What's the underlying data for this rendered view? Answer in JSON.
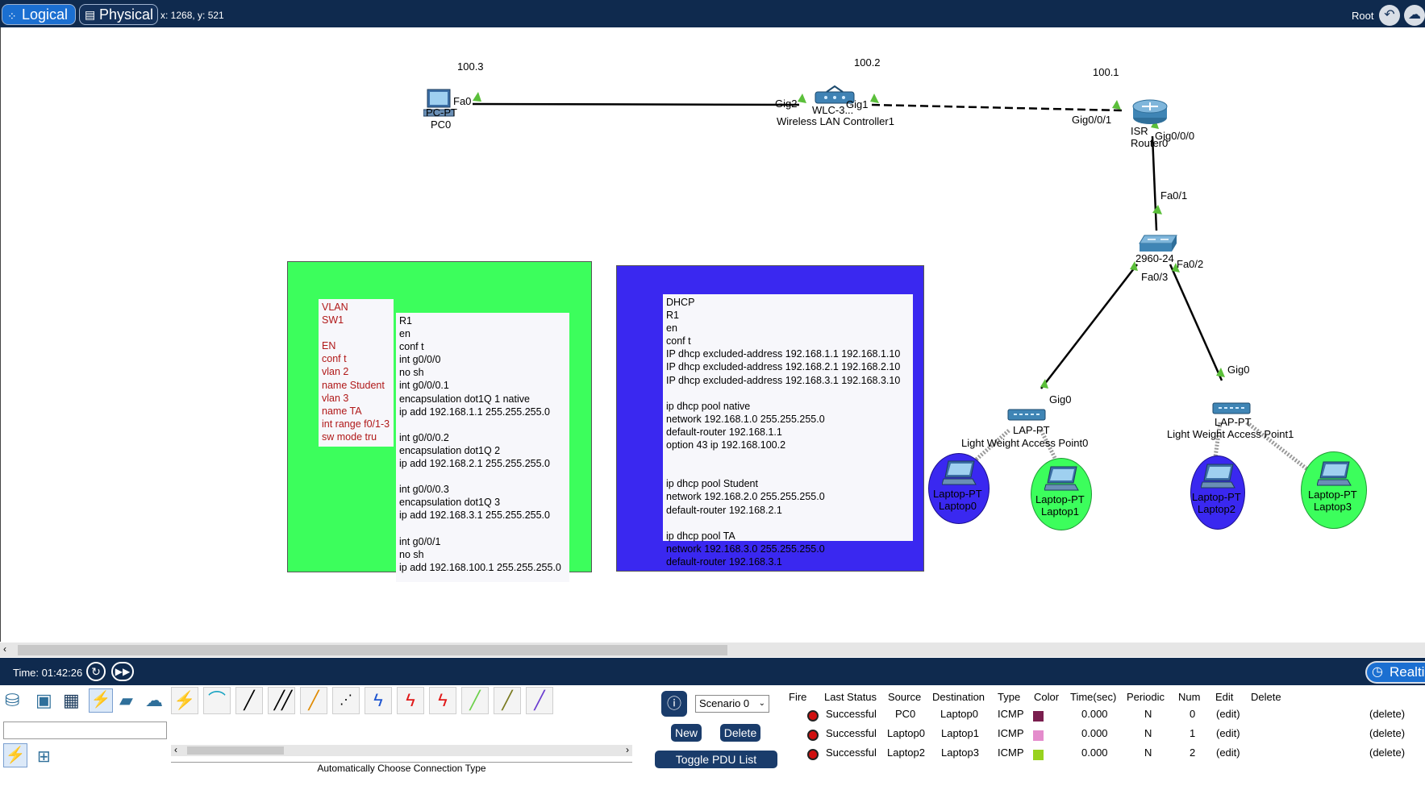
{
  "topbar": {
    "logical_label": "Logical",
    "physical_label": "Physical",
    "coords": "x: 1268, y: 521",
    "root_label": "Root"
  },
  "devices": {
    "pc": {
      "ip": "100.3",
      "port": "Fa0",
      "type": "PC-PT",
      "name": "PC0"
    },
    "wlc": {
      "ip": "100.2",
      "port_left": "Gig2",
      "port_right": "Gig1",
      "type": "WLC-3...",
      "name": "Wireless LAN Controller1"
    },
    "router": {
      "ip": "100.1",
      "port_left": "Gig0/0/1",
      "port_right": "Gig0/0/0",
      "type": "ISR",
      "name": "Router0"
    },
    "switch": {
      "port_top": "Fa0/1",
      "type": "2960-24",
      "port_right": "Fa0/2",
      "port_left": "Fa0/3"
    },
    "lap0": {
      "port": "Gig0",
      "type": "LAP-PT",
      "name": "Light Weight Access Point0"
    },
    "lap1": {
      "port": "Gig0",
      "type": "LAP-PT",
      "name": "Light Weight Access Point1"
    },
    "laptops": [
      {
        "type": "Laptop-PT",
        "name": "Laptop0"
      },
      {
        "type": "Laptop-PT",
        "name": "Laptop1"
      },
      {
        "type": "Laptop-PT",
        "name": "Laptop2"
      },
      {
        "type": "Laptop-PT",
        "name": "Laptop3"
      }
    ]
  },
  "notes": {
    "vlan": "VLAN\nSW1\n\nEN\nconf t\nvlan 2\nname Student\nvlan 3\nname TA\nint range f0/1-3\nsw mode tru",
    "r1": "R1\nen\nconf t\nint g0/0/0\nno sh\nint g0/0/0.1\nencapsulation dot1Q 1 native\nip add 192.168.1.1 255.255.255.0\n\nint g0/0/0.2\nencapsulation dot1Q 2\nip add 192.168.2.1 255.255.255.0\n\nint g0/0/0.3\nencapsulation dot1Q 3\nip add 192.168.3.1 255.255.255.0\n\nint g0/0/1\nno sh\nip add 192.168.100.1 255.255.255.0",
    "dhcp": "DHCP\nR1\nen\nconf t\nIP dhcp excluded-address 192.168.1.1 192.168.1.10\nIP dhcp excluded-address 192.168.2.1 192.168.2.10\nIP dhcp excluded-address 192.168.3.1 192.168.3.10\n\nip dhcp pool native\nnetwork 192.168.1.0 255.255.255.0\ndefault-router 192.168.1.1\noption 43 ip 192.168.100.2\n\n\nip dhcp pool Student\nnetwork 192.168.2.0 255.255.255.0\ndefault-router 192.168.2.1\n\nip dhcp pool TA\nnetwork 192.168.3.0 255.255.255.0\ndefault-router 192.168.3.1"
  },
  "colors": {
    "green_cluster": "#3cfe5c",
    "blue_cluster": "#3a28f0",
    "vlan_text": "#b01818"
  },
  "timebar": {
    "time": "Time: 01:42:26",
    "realtime": "Realti"
  },
  "toolbox": {
    "connection_type": "Automatically Choose Connection Type"
  },
  "scenario": {
    "selected": "Scenario 0",
    "new_label": "New",
    "delete_label": "Delete",
    "toggle_label": "Toggle PDU List Window"
  },
  "pdu": {
    "headers": [
      "Fire",
      "Last Status",
      "Source",
      "Destination",
      "Type",
      "Color",
      "Time(sec)",
      "Periodic",
      "Num",
      "Edit",
      "Delete"
    ],
    "rows": [
      {
        "status": "Successful",
        "source": "PC0",
        "destination": "Laptop0",
        "type": "ICMP",
        "color": "#7a1e4e",
        "time": "0.000",
        "periodic": "N",
        "num": "0",
        "edit": "(edit)",
        "delete": "(delete)"
      },
      {
        "status": "Successful",
        "source": "Laptop0",
        "destination": "Laptop1",
        "type": "ICMP",
        "color": "#e48ccc",
        "time": "0.000",
        "periodic": "N",
        "num": "1",
        "edit": "(edit)",
        "delete": "(delete)"
      },
      {
        "status": "Successful",
        "source": "Laptop2",
        "destination": "Laptop3",
        "type": "ICMP",
        "color": "#98d21e",
        "time": "0.000",
        "periodic": "N",
        "num": "2",
        "edit": "(edit)",
        "delete": "(delete)"
      }
    ]
  }
}
